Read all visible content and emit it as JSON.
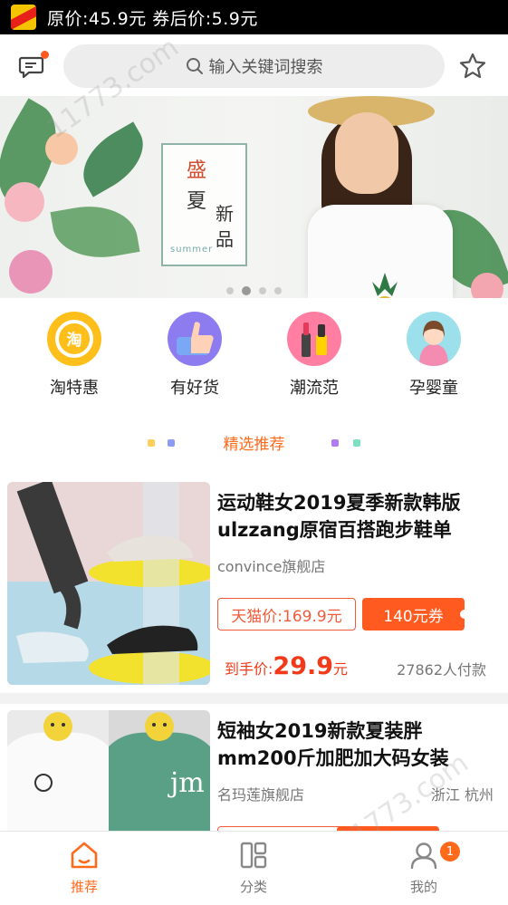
{
  "status": {
    "text": "原价:45.9元 券后价:5.9元"
  },
  "search": {
    "placeholder": "输入关键词搜索"
  },
  "banner": {
    "badge_char": "盛",
    "chars": [
      "夏",
      "新",
      "品"
    ],
    "sub": "summer",
    "slide_count": 4,
    "active_slide": 2
  },
  "categories": [
    {
      "label": "淘特惠",
      "icon": "tao-coin-icon",
      "color": "#ffbf1a"
    },
    {
      "label": "有好货",
      "icon": "thumbs-up-icon",
      "color": "#8c7cf0"
    },
    {
      "label": "潮流范",
      "icon": "makeup-icon",
      "color": "#ff7ea1"
    },
    {
      "label": "孕婴童",
      "icon": "mother-icon",
      "color": "#ffa9c0"
    }
  ],
  "section": {
    "title": "精选推荐"
  },
  "products": [
    {
      "title": "运动鞋女2019夏季新款韩版ulzzang原宿百搭跑步鞋单",
      "shop": "convince旗舰店",
      "location": "",
      "tmall_price": "天猫价:169.9元",
      "coupon": "140元券",
      "final_prefix": "到手价:",
      "final_price": "29.9",
      "final_unit": "元",
      "sold": "27862人付款"
    },
    {
      "title": "短袖女2019新款夏装胖mm200斤加肥加大码女装",
      "shop": "名玛莲旗舰店",
      "location": "浙江 杭州",
      "tmall_price": "",
      "coupon": "",
      "final_prefix": "",
      "final_price": "",
      "final_unit": "",
      "sold": ""
    }
  ],
  "tabs": [
    {
      "label": "推荐",
      "icon": "home-icon",
      "active": true
    },
    {
      "label": "分类",
      "icon": "category-icon",
      "active": false
    },
    {
      "label": "我的",
      "icon": "user-icon",
      "active": false
    }
  ],
  "notification_badge": "1",
  "colors": {
    "accent": "#ff6a1a",
    "price_red": "#f23a1a",
    "coupon": "#ff5a1f"
  }
}
